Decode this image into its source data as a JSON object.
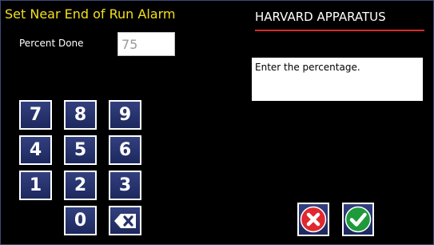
{
  "header": {
    "title": "Set Near End of Run Alarm",
    "brand": "HARVARD APPARATUS"
  },
  "field": {
    "label": "Percent Done",
    "value": "75"
  },
  "hint": "Enter the percentage.",
  "keypad": {
    "keys": [
      "7",
      "8",
      "9",
      "4",
      "5",
      "6",
      "1",
      "2",
      "3",
      "0"
    ],
    "backspace_icon": "backspace-icon"
  },
  "actions": {
    "cancel_icon": "cancel-icon",
    "confirm_icon": "checkmark-icon"
  },
  "colors": {
    "title": "#f2e01c",
    "brand_underline": "#d92b2b",
    "key_fill": "#263270",
    "cancel": "#e0282e",
    "confirm": "#1e9a3a"
  }
}
